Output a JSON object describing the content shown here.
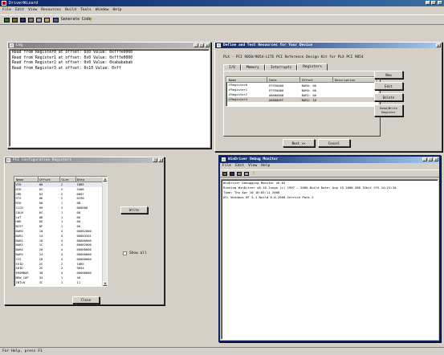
{
  "app": {
    "title": "DriverWizard",
    "menu": [
      "File",
      "Edit",
      "View",
      "Resources",
      "Build",
      "Tools",
      "Window",
      "Help"
    ],
    "toolbar": {
      "generate_label": "Generate Code"
    },
    "status": "For Help, press F1"
  },
  "log_window": {
    "title": "Log",
    "lines": [
      "Read from Register0 at offset: 0x0 Value: 0xfffe0000",
      "Read from Register1 at offset: 0x0 Value: 0xfffe0000",
      "Read from Register2 at offset: 0x0 Value: 0xabababab",
      "Read from Register3 at offset: 0x10 Value: 0xff"
    ]
  },
  "resources_window": {
    "title": "Define and Test Resources for Your Device",
    "subtitle": "PLX - PCI 9050/9054-LITE PCI Reference Design Kit for PLX PCI 9054",
    "tabs": [
      "I/O",
      "Memory",
      "Interrupts",
      "Registers"
    ],
    "columns": [
      "Name",
      "Data",
      "Offset",
      "Description"
    ],
    "rows": [
      {
        "name": "Register0",
        "data": "FFFE0000",
        "offset": "BAR0: 00",
        "desc": ""
      },
      {
        "name": "Register1",
        "data": "FFFE0000",
        "offset": "BAR0: 00",
        "desc": ""
      },
      {
        "name": "Register2",
        "data": "ABABABAB",
        "offset": "BAR2: 00",
        "desc": ""
      },
      {
        "name": "Register3",
        "data": "000000FF",
        "offset": "BAR2: 10",
        "desc": ""
      }
    ],
    "buttons": {
      "new": "New",
      "edit": "Edit",
      "delete": "Delete",
      "rw": "Read/Write Register",
      "next": "Next >>",
      "cancel": "Cancel"
    }
  },
  "pci_window": {
    "title": "PCI Configuration Registers",
    "columns": [
      "Name",
      "Offset",
      "Size",
      "Data"
    ],
    "rows": [
      [
        "VID",
        "00",
        "2",
        "10B5"
      ],
      [
        "DID",
        "02",
        "2",
        "5406"
      ],
      [
        "CMD",
        "04",
        "2",
        "0007"
      ],
      [
        "STS",
        "06",
        "2",
        "0290"
      ],
      [
        "RID",
        "08",
        "1",
        "0B"
      ],
      [
        "CLCD",
        "09",
        "3",
        "068000"
      ],
      [
        "CALN",
        "0C",
        "1",
        "08"
      ],
      [
        "LAT",
        "0D",
        "1",
        "00"
      ],
      [
        "HDR",
        "0E",
        "1",
        "00"
      ],
      [
        "BIST",
        "0F",
        "1",
        "00"
      ],
      [
        "BAR0",
        "10",
        "4",
        "00082000"
      ],
      [
        "BAR1",
        "14",
        "4",
        "00003201"
      ],
      [
        "BAR2",
        "18",
        "4",
        "80000000"
      ],
      [
        "BAR3",
        "1C",
        "4",
        "80002000"
      ],
      [
        "BAR4",
        "20",
        "4",
        "00000000"
      ],
      [
        "BAR5",
        "24",
        "4",
        "00000000"
      ],
      [
        "CIS",
        "28",
        "4",
        "00000000"
      ],
      [
        "SVID",
        "2C",
        "2",
        "10B5"
      ],
      [
        "SDID",
        "2E",
        "2",
        "9054"
      ],
      [
        "EROMBAR",
        "30",
        "4",
        "00000000"
      ],
      [
        "NEW_CAP",
        "34",
        "1",
        "40"
      ],
      [
        "INTLN",
        "3C",
        "1",
        "11"
      ]
    ],
    "write_label": "Write",
    "show_all_label": "Show all",
    "close_label": "Close"
  },
  "debug_window": {
    "title": "WinDriver Debug Monitor",
    "menu": [
      "File",
      "Edit",
      "View",
      "Help"
    ],
    "lines": [
      "WinDriver Debugging Monitor v6.02",
      "Running WinDriver v6.10 Jungo (c) 1997 - 2006 Build Date: Aug 15 2006 X86 32bit SYS 14:21:34",
      "Time: Thu Apr 10 18:05:11 2008",
      "OS: Windows NT 5.1 Build 0.0.2600 Service Pack 2"
    ]
  },
  "colors": {
    "accent": "#0a246a",
    "desktop": "#d4d0c8",
    "check": "#008000"
  }
}
